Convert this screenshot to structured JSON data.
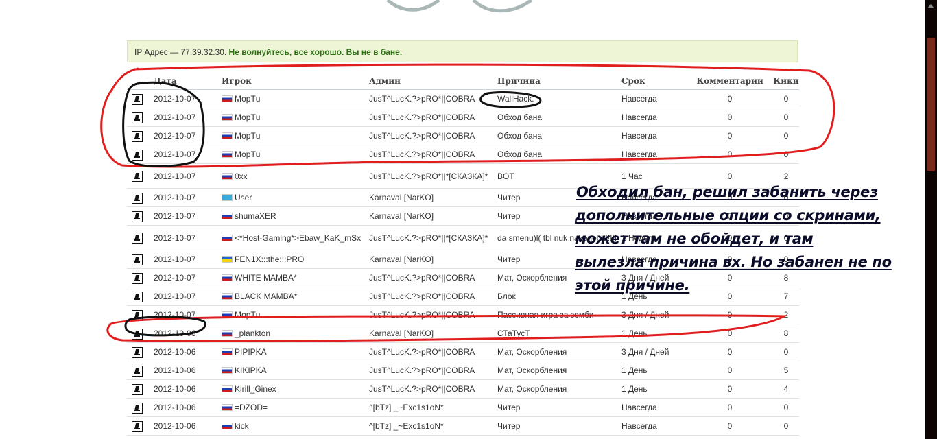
{
  "notice": {
    "ip_text": "IP Адрес — 77.39.32.30. ",
    "ok_text": "Не волнуйтесь, все хорошо. Вы не в бане."
  },
  "columns": [
    "",
    "Дата",
    "Игрок",
    "Админ",
    "Причина",
    "Срок",
    "Комментарии",
    "Кики"
  ],
  "rows": [
    {
      "date": "2012-10-07",
      "flag": "ru",
      "player": "МорТu",
      "admin": "JusT^LucK.?>pRO*||COBRA",
      "reason": "WallHack.",
      "term": "Навсегда",
      "comments": "0",
      "kicks": "0"
    },
    {
      "date": "2012-10-07",
      "flag": "ru",
      "player": "МорТu",
      "admin": "JusT^LucK.?>pRO*||COBRA",
      "reason": "Обход бана",
      "term": "Навсегда",
      "comments": "0",
      "kicks": "0"
    },
    {
      "date": "2012-10-07",
      "flag": "ru",
      "player": "МорТu",
      "admin": "JusT^LucK.?>pRO*||COBRA",
      "reason": "Обход бана",
      "term": "Навсегда",
      "comments": "0",
      "kicks": "0"
    },
    {
      "date": "2012-10-07",
      "flag": "ru",
      "player": "МорТu",
      "admin": "JusT^LucK.?>pRO*||COBRA",
      "reason": "Обход бана",
      "term": "Навсегда",
      "comments": "0",
      "kicks": "0"
    },
    {
      "date": "2012-10-07",
      "flag": "ru",
      "player": "0xx",
      "admin": "JusT^LucK.?>pRO*||*[СКАЗКА]*",
      "reason": "BOT",
      "term": "1 Час",
      "comments": "0",
      "kicks": "2"
    },
    {
      "date": "2012-10-07",
      "flag": "kz",
      "player": "User",
      "admin": "Karnaval [NarKO]",
      "reason": "Читер",
      "term": "Навсегда",
      "comments": "0",
      "kicks": "0"
    },
    {
      "date": "2012-10-07",
      "flag": "ru",
      "player": "shumaXER",
      "admin": "Karnaval [NarKO]",
      "reason": "Читер",
      "term": "Навсегда",
      "comments": "0",
      "kicks": "0"
    },
    {
      "date": "2012-10-07",
      "flag": "ru",
      "player": "<*Host-Gaming*>Ebaw_KaK_mSx",
      "admin": "JusT^LucK.?>pRO*||*[СКАЗКА]*",
      "reason": "da smenu)l( tbl nuk nakonec!!!!!!!",
      "term": "1 Неделя",
      "comments": "0",
      "kicks": "0"
    },
    {
      "date": "2012-10-07",
      "flag": "ua",
      "player": "FEN1X:::the:::PRO",
      "admin": "Karnaval [NarKO]",
      "reason": "Читер",
      "term": "Навсегда",
      "comments": "0",
      "kicks": "0"
    },
    {
      "date": "2012-10-07",
      "flag": "ru",
      "player": "WHITE MAMBA*",
      "admin": "JusT^LucK.?>pRO*||COBRA",
      "reason": "Мат, Оскорбления",
      "term": "3 Дня / Дней",
      "comments": "0",
      "kicks": "8"
    },
    {
      "date": "2012-10-07",
      "flag": "ru",
      "player": "BLACK MAMBA*",
      "admin": "JusT^LucK.?>pRO*||COBRA",
      "reason": "Блок",
      "term": "1 День",
      "comments": "0",
      "kicks": "7"
    },
    {
      "date": "2012-10-07",
      "flag": "ru",
      "player": "МорТu",
      "admin": "JusT^LucK.?>pRO*||COBRA",
      "reason": "Пассивная игра за зомби",
      "term": "3 Дня / Дней",
      "comments": "0",
      "kicks": "2"
    },
    {
      "date": "2012-10-06",
      "flag": "ru",
      "player": "_plankton",
      "admin": "Karnaval [NarKO]",
      "reason": "СТаТусТ",
      "term": "1 День",
      "comments": "0",
      "kicks": "8"
    },
    {
      "date": "2012-10-06",
      "flag": "ru",
      "player": "PIPIPKA",
      "admin": "JusT^LucK.?>pRO*||COBRA",
      "reason": "Мат, Оскорбления",
      "term": "3 Дня / Дней",
      "comments": "0",
      "kicks": "0"
    },
    {
      "date": "2012-10-06",
      "flag": "ru",
      "player": "KIKIPKA",
      "admin": "JusT^LucK.?>pRO*||COBRA",
      "reason": "Мат, Оскорбления",
      "term": "1 День",
      "comments": "0",
      "kicks": "5"
    },
    {
      "date": "2012-10-06",
      "flag": "ru",
      "player": "Kirill_Ginex",
      "admin": "JusT^LucK.?>pRO*||COBRA",
      "reason": "Мат, Оскорбления",
      "term": "1 День",
      "comments": "0",
      "kicks": "4"
    },
    {
      "date": "2012-10-06",
      "flag": "ru",
      "player": "=DZOD=",
      "admin": "^[bTz] _~Exc1s1oN*",
      "reason": "Читер",
      "term": "Навсегда",
      "comments": "0",
      "kicks": "0"
    },
    {
      "date": "2012-10-06",
      "flag": "ru",
      "player": "kick",
      "admin": "^[bTz] _~Exc1s1oN*",
      "reason": "Читер",
      "term": "Навсегда",
      "comments": "0",
      "kicks": "0"
    }
  ],
  "annotation": {
    "lines": [
      "Обходил бан, решил забанить через",
      "дополнительные опции со скринами,",
      "может там не обойдет, и там",
      "вылезла причина вх. Но забанен не по",
      "этой причине."
    ],
    "ink_color": "#e01e1e",
    "marker_color": "#111111"
  }
}
